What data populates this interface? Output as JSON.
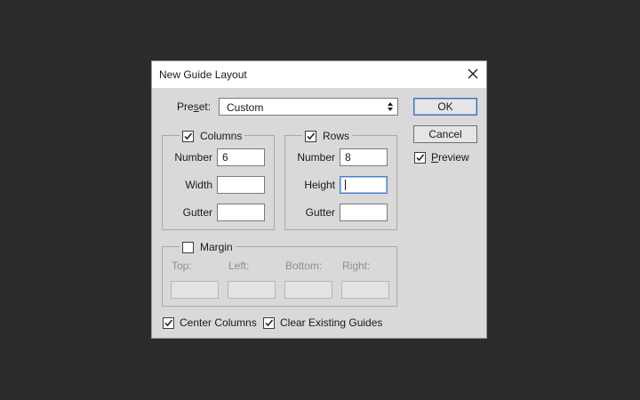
{
  "dialog": {
    "title": "New Guide Layout"
  },
  "preset": {
    "label_pre": "Pre",
    "label_underlined": "s",
    "label_post": "et:",
    "value": "Custom"
  },
  "buttons": {
    "ok": "OK",
    "cancel": "Cancel"
  },
  "preview": {
    "label_underlined": "P",
    "label_rest": "review",
    "checked": true
  },
  "columns": {
    "label": "Columns",
    "checked": true,
    "number_label": "Number",
    "number_value": "6",
    "width_label": "Width",
    "width_value": "",
    "gutter_label": "Gutter",
    "gutter_value": ""
  },
  "rows": {
    "label": "Rows",
    "checked": true,
    "number_label": "Number",
    "number_value": "8",
    "height_label": "Height",
    "height_value": "",
    "gutter_label": "Gutter",
    "gutter_value": ""
  },
  "margin": {
    "label": "Margin",
    "checked": false,
    "top_label": "Top:",
    "left_label": "Left:",
    "bottom_label": "Bottom:",
    "right_label": "Right:"
  },
  "options": {
    "center_columns": "Center Columns",
    "center_columns_checked": true,
    "clear_guides": "Clear Existing Guides",
    "clear_guides_checked": true
  }
}
